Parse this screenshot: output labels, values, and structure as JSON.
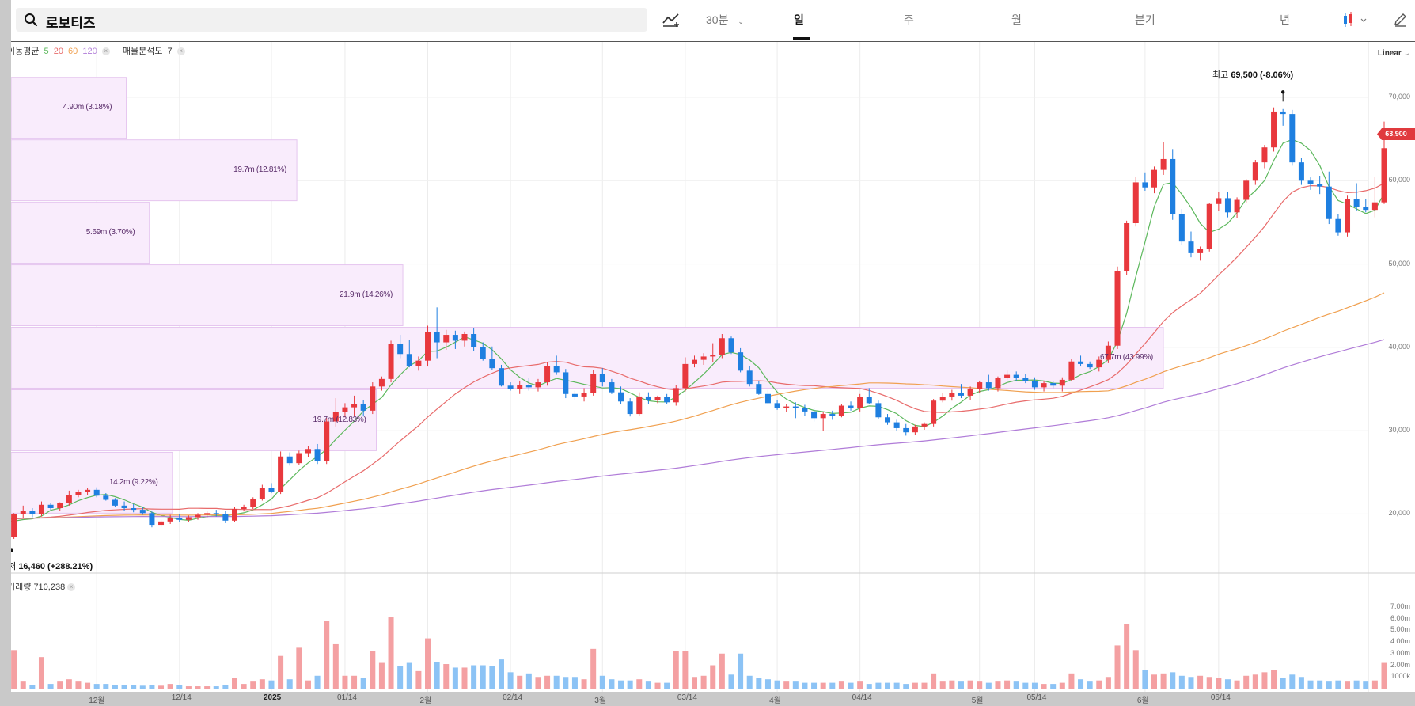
{
  "header": {
    "stock_name": "로보티즈",
    "interval_label": "30분",
    "tabs": [
      "일",
      "주",
      "월",
      "분기",
      "년"
    ],
    "active_tab": "일"
  },
  "legend": {
    "ma_label": "이동평균",
    "ma_periods": [
      "5",
      "20",
      "60",
      "120"
    ],
    "ma_colors": [
      "#5cb85c",
      "#e86b6b",
      "#f0a050",
      "#b07cd8"
    ],
    "volume_profile_label": "매물분석도",
    "volume_profile_value": "7"
  },
  "scale_label": "Linear",
  "current_price": "63,900",
  "high_label": {
    "prefix": "최고",
    "value": "69,500",
    "pct": "(-8.06%)"
  },
  "low_label": {
    "prefix": "최저",
    "value": "16,460",
    "pct": "(+288.21%)"
  },
  "volume_legend": {
    "label": "거래량",
    "value": "710,238"
  },
  "colors": {
    "up": "#e8383d",
    "down": "#1e7fe0",
    "vol_up": "#f4a0a2",
    "vol_down": "#8cc3f5",
    "profile": "#f9ecfc",
    "profile_border": "#e5c5ef"
  },
  "chart_data": {
    "type": "candlestick",
    "ylim": [
      15000,
      72000
    ],
    "y_ticks": [
      "70,000",
      "60,000",
      "50,000",
      "40,000",
      "30,000",
      "20,000"
    ],
    "y_tick_values": [
      70000,
      60000,
      50000,
      40000,
      30000,
      20000
    ],
    "volume_ylim": [
      0,
      8000000
    ],
    "volume_ticks": [
      "7.00m",
      "6.00m",
      "5.00m",
      "4.00m",
      "3.00m",
      "2.00m",
      "1000k"
    ],
    "volume_tick_values": [
      7000000,
      6000000,
      5000000,
      4000000,
      3000000,
      2000000,
      1000000
    ],
    "x_labels": [
      "12월",
      "12/14",
      "2025",
      "01/14",
      "2월",
      "02/14",
      "3월",
      "03/14",
      "4월",
      "04/14",
      "5월",
      "05/14",
      "6월",
      "06/14"
    ],
    "x_label_index": [
      10,
      19,
      29,
      37,
      46,
      55,
      65,
      74,
      84,
      93,
      106,
      112,
      124,
      132
    ],
    "x_label_bold": [
      false,
      false,
      true,
      false,
      false,
      false,
      false,
      false,
      false,
      false,
      false,
      false,
      false,
      false
    ],
    "volume_profile": [
      {
        "from": 65000,
        "to": 72500,
        "label": "4.90m (3.18%)",
        "frac": 0.1
      },
      {
        "from": 57500,
        "to": 65000,
        "label": "19.7m (12.81%)",
        "frac": 0.248
      },
      {
        "from": 50000,
        "to": 57500,
        "label": "5.69m (3.70%)",
        "frac": 0.12
      },
      {
        "from": 42500,
        "to": 50000,
        "label": "21.9m (14.26%)",
        "frac": 0.34
      },
      {
        "from": 35000,
        "to": 42500,
        "label": "67.7m (43.99%)",
        "frac": 1.0
      },
      {
        "from": 27500,
        "to": 35000,
        "label": "19.7m (12.83%)",
        "frac": 0.317
      },
      {
        "from": 20000,
        "to": 27500,
        "label": "14.2m (9.22%)",
        "frac": 0.14
      }
    ],
    "candles": [
      [
        17500,
        18200,
        16460,
        17200,
        1500000
      ],
      [
        17200,
        20100,
        17000,
        20000,
        3300000
      ],
      [
        20000,
        21000,
        19500,
        20400,
        600000
      ],
      [
        20400,
        20700,
        19600,
        20000,
        300000
      ],
      [
        20000,
        21500,
        19700,
        21100,
        2700000
      ],
      [
        21100,
        21300,
        20500,
        20700,
        400000
      ],
      [
        20700,
        21400,
        20400,
        21300,
        600000
      ],
      [
        21300,
        22800,
        21000,
        22300,
        800000
      ],
      [
        22300,
        22900,
        22000,
        22600,
        600000
      ],
      [
        22600,
        23100,
        22300,
        22900,
        500000
      ],
      [
        22900,
        23200,
        22000,
        22200,
        400000
      ],
      [
        22200,
        22500,
        21600,
        21700,
        400000
      ],
      [
        21700,
        21900,
        20800,
        21000,
        300000
      ],
      [
        21000,
        21500,
        20400,
        20700,
        300000
      ],
      [
        20700,
        21200,
        20200,
        20500,
        300000
      ],
      [
        20500,
        20800,
        19900,
        20100,
        250000
      ],
      [
        20100,
        20300,
        18400,
        18700,
        300000
      ],
      [
        18700,
        19300,
        18400,
        19100,
        250000
      ],
      [
        19100,
        19900,
        18800,
        19500,
        400000
      ],
      [
        19500,
        20000,
        19000,
        19300,
        300000
      ],
      [
        19300,
        19800,
        19000,
        19600,
        200000
      ],
      [
        19600,
        20100,
        19300,
        19900,
        200000
      ],
      [
        19900,
        20300,
        19500,
        20100,
        200000
      ],
      [
        20100,
        20500,
        19700,
        20000,
        200000
      ],
      [
        20000,
        20400,
        18900,
        19200,
        300000
      ],
      [
        19200,
        20800,
        19000,
        20600,
        900000
      ],
      [
        20600,
        21100,
        20300,
        20800,
        400000
      ],
      [
        20800,
        22000,
        20600,
        21800,
        600000
      ],
      [
        21800,
        23500,
        21600,
        23100,
        800000
      ],
      [
        23100,
        23700,
        22500,
        22600,
        700000
      ],
      [
        22600,
        27500,
        22400,
        26900,
        2800000
      ],
      [
        26900,
        27400,
        25800,
        26100,
        800000
      ],
      [
        26100,
        27600,
        25900,
        27300,
        3500000
      ],
      [
        27300,
        28200,
        26800,
        27800,
        700000
      ],
      [
        27800,
        28400,
        26000,
        26400,
        1100000
      ],
      [
        26400,
        31500,
        26000,
        31100,
        5800000
      ],
      [
        31100,
        33900,
        30500,
        32200,
        3800000
      ],
      [
        32200,
        33300,
        31600,
        32800,
        1100000
      ],
      [
        32800,
        34200,
        31800,
        33200,
        1100000
      ],
      [
        33200,
        33700,
        31700,
        32400,
        900000
      ],
      [
        32400,
        35800,
        32000,
        35300,
        3200000
      ],
      [
        35300,
        36500,
        34800,
        36200,
        2200000
      ],
      [
        36200,
        40800,
        35800,
        40400,
        6100000
      ],
      [
        40400,
        41500,
        38700,
        39200,
        1900000
      ],
      [
        39200,
        40900,
        37600,
        37800,
        2200000
      ],
      [
        37800,
        38900,
        37200,
        38400,
        1500000
      ],
      [
        38400,
        42600,
        37700,
        41800,
        4300000
      ],
      [
        41800,
        44800,
        38700,
        40600,
        2300000
      ],
      [
        40600,
        42100,
        39700,
        41500,
        2100000
      ],
      [
        41500,
        42000,
        39800,
        40800,
        1800000
      ],
      [
        40800,
        41900,
        40100,
        41600,
        1800000
      ],
      [
        41600,
        42300,
        39600,
        40000,
        2000000
      ],
      [
        40000,
        40600,
        38400,
        38600,
        2000000
      ],
      [
        38600,
        40100,
        37300,
        37500,
        1900000
      ],
      [
        37500,
        37900,
        35300,
        35400,
        2500000
      ],
      [
        35400,
        35800,
        34800,
        35000,
        1400000
      ],
      [
        35000,
        36000,
        34400,
        35500,
        1100000
      ],
      [
        35500,
        36300,
        34800,
        35200,
        1300000
      ],
      [
        35200,
        36200,
        34700,
        35800,
        1000000
      ],
      [
        35800,
        38200,
        35400,
        37800,
        1100000
      ],
      [
        37800,
        39000,
        36700,
        37000,
        1100000
      ],
      [
        37000,
        37400,
        33900,
        34400,
        1000000
      ],
      [
        34400,
        34800,
        33700,
        34100,
        1000000
      ],
      [
        34100,
        35100,
        33500,
        34500,
        800000
      ],
      [
        34500,
        37300,
        34200,
        36800,
        3400000
      ],
      [
        36800,
        37500,
        35300,
        35800,
        1100000
      ],
      [
        35800,
        36200,
        34400,
        34600,
        800000
      ],
      [
        34600,
        35300,
        33200,
        33500,
        700000
      ],
      [
        33500,
        33900,
        31700,
        32000,
        700000
      ],
      [
        32000,
        34600,
        31800,
        34100,
        800000
      ],
      [
        34100,
        34600,
        33200,
        33700,
        600000
      ],
      [
        33700,
        34200,
        33300,
        34000,
        500000
      ],
      [
        34000,
        34400,
        33200,
        33400,
        500000
      ],
      [
        33400,
        35500,
        33000,
        35100,
        3200000
      ],
      [
        35100,
        38800,
        34700,
        38000,
        3200000
      ],
      [
        38000,
        39000,
        37600,
        38500,
        1000000
      ],
      [
        38500,
        39300,
        37900,
        38900,
        1100000
      ],
      [
        38900,
        40500,
        38200,
        39100,
        2000000
      ],
      [
        39100,
        41600,
        38700,
        41100,
        3000000
      ],
      [
        41100,
        41300,
        39200,
        39400,
        1200000
      ],
      [
        39400,
        39900,
        37000,
        37200,
        3000000
      ],
      [
        37200,
        37800,
        35300,
        35600,
        1100000
      ],
      [
        35600,
        35900,
        34300,
        34400,
        900000
      ],
      [
        34400,
        34900,
        33200,
        33300,
        800000
      ],
      [
        33300,
        33700,
        32500,
        32700,
        700000
      ],
      [
        32700,
        33200,
        32200,
        32900,
        600000
      ],
      [
        32900,
        33400,
        31500,
        32700,
        600000
      ],
      [
        32700,
        33100,
        31800,
        32300,
        500000
      ],
      [
        32300,
        32700,
        31100,
        31500,
        500000
      ],
      [
        31500,
        32200,
        30000,
        32000,
        500000
      ],
      [
        32000,
        32400,
        31300,
        31800,
        500000
      ],
      [
        31800,
        33200,
        31600,
        33000,
        600000
      ],
      [
        33000,
        33500,
        32400,
        32700,
        500000
      ],
      [
        32700,
        34400,
        32300,
        34000,
        600000
      ],
      [
        34000,
        35100,
        33200,
        33300,
        400000
      ],
      [
        33300,
        33600,
        31400,
        31600,
        500000
      ],
      [
        31600,
        32000,
        30700,
        31000,
        500000
      ],
      [
        31000,
        31300,
        30000,
        30300,
        500000
      ],
      [
        30300,
        30800,
        29400,
        29800,
        400000
      ],
      [
        29800,
        30700,
        29500,
        30500,
        500000
      ],
      [
        30500,
        31000,
        30100,
        30800,
        500000
      ],
      [
        30800,
        33800,
        30500,
        33600,
        1300000
      ],
      [
        33600,
        34500,
        33400,
        34000,
        600000
      ],
      [
        34000,
        34900,
        33600,
        34500,
        700000
      ],
      [
        34500,
        35600,
        33900,
        34200,
        600000
      ],
      [
        34200,
        35300,
        33700,
        35000,
        700000
      ],
      [
        35000,
        36000,
        34500,
        35800,
        600000
      ],
      [
        35800,
        36700,
        34800,
        35100,
        500000
      ],
      [
        35100,
        36500,
        34700,
        36300,
        600000
      ],
      [
        36300,
        37200,
        36100,
        36700,
        700000
      ],
      [
        36700,
        37100,
        36000,
        36300,
        600000
      ],
      [
        36300,
        36800,
        35700,
        35900,
        500000
      ],
      [
        35900,
        36400,
        34900,
        35200,
        500000
      ],
      [
        35200,
        36000,
        34700,
        35700,
        400000
      ],
      [
        35700,
        36000,
        35100,
        35400,
        400000
      ],
      [
        35400,
        36400,
        34700,
        36100,
        500000
      ],
      [
        36100,
        38600,
        35900,
        38300,
        1300000
      ],
      [
        38300,
        39000,
        37700,
        38000,
        800000
      ],
      [
        38000,
        38300,
        37400,
        37600,
        600000
      ],
      [
        37600,
        38900,
        37100,
        38500,
        700000
      ],
      [
        38500,
        40700,
        38100,
        40200,
        1000000
      ],
      [
        40200,
        49700,
        39800,
        49200,
        3700000
      ],
      [
        49200,
        55200,
        48700,
        54900,
        5500000
      ],
      [
        54900,
        60500,
        54500,
        59800,
        3300000
      ],
      [
        59800,
        61000,
        58800,
        59200,
        1600000
      ],
      [
        59200,
        61700,
        58500,
        61300,
        1200000
      ],
      [
        61300,
        64600,
        60700,
        62600,
        1300000
      ],
      [
        62600,
        63800,
        55300,
        56000,
        1400000
      ],
      [
        56000,
        56600,
        52300,
        52700,
        1100000
      ],
      [
        52700,
        53900,
        50800,
        51300,
        1000000
      ],
      [
        51300,
        52100,
        50400,
        51800,
        1100000
      ],
      [
        51800,
        57300,
        51500,
        57200,
        1000000
      ],
      [
        57200,
        58700,
        56400,
        57900,
        900000
      ],
      [
        57900,
        58700,
        55600,
        56200,
        800000
      ],
      [
        56200,
        58000,
        55500,
        57700,
        700000
      ],
      [
        57700,
        60200,
        57300,
        60000,
        1100000
      ],
      [
        60000,
        62500,
        59500,
        62200,
        1200000
      ],
      [
        62200,
        64300,
        61500,
        64000,
        1400000
      ],
      [
        64000,
        68800,
        63500,
        68300,
        1600000
      ],
      [
        68300,
        68600,
        66600,
        68000,
        900000
      ],
      [
        68000,
        68500,
        61800,
        62200,
        1200000
      ],
      [
        62200,
        62700,
        59500,
        60000,
        1000000
      ],
      [
        60000,
        60400,
        58900,
        59600,
        700000
      ],
      [
        59600,
        60600,
        58400,
        59300,
        700000
      ],
      [
        59300,
        61100,
        54800,
        55400,
        600000
      ],
      [
        55400,
        56000,
        53400,
        53800,
        700000
      ],
      [
        53800,
        58200,
        53300,
        57800,
        600000
      ],
      [
        57800,
        59700,
        56400,
        56800,
        700000
      ],
      [
        56800,
        57800,
        56200,
        56500,
        600000
      ],
      [
        56500,
        60500,
        55600,
        57400,
        700000
      ],
      [
        57400,
        67100,
        57200,
        63900,
        2200000
      ]
    ],
    "ma_series_start": [
      0,
      0,
      0,
      0
    ]
  }
}
